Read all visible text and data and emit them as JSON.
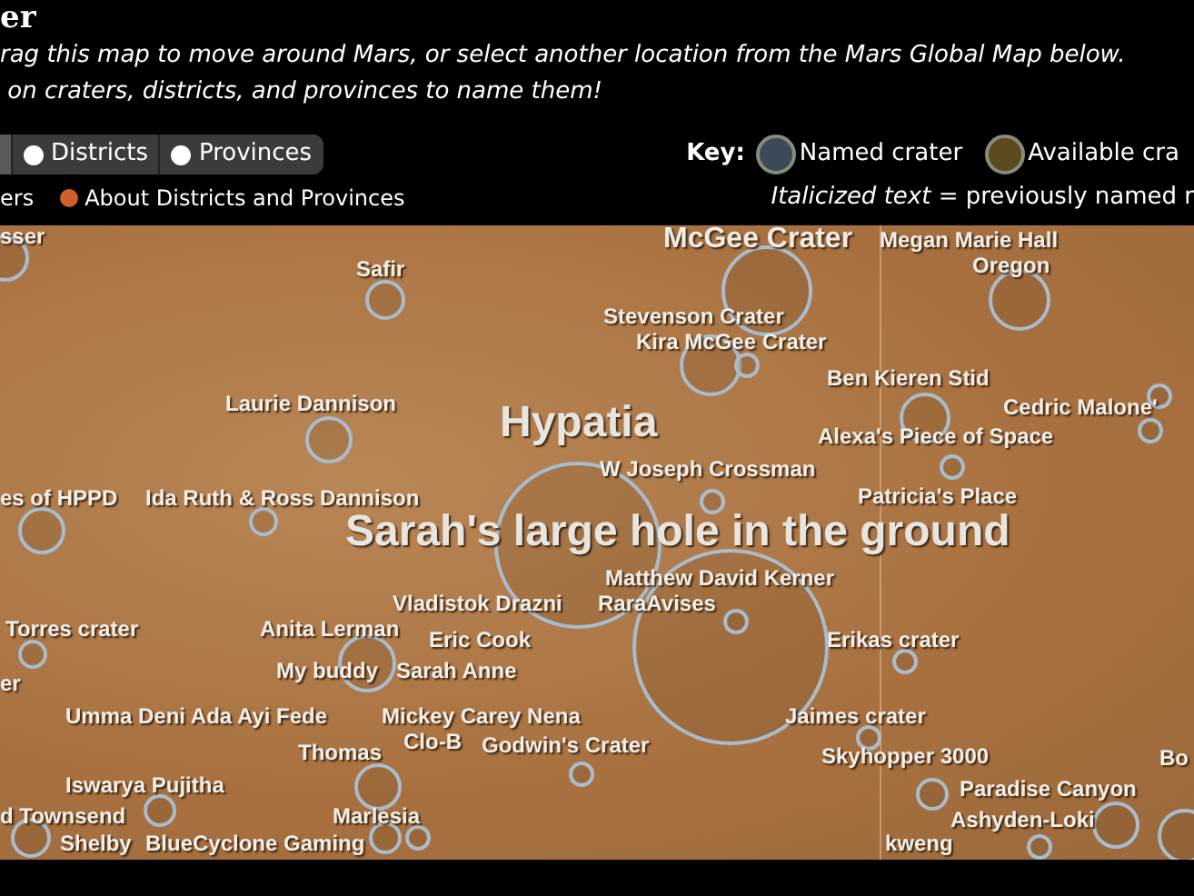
{
  "header": {
    "title": "er",
    "instructions": [
      "rag this map to move around Mars, or select another location from the Mars Global Map below.",
      " on craters, districts, and provinces to name them!"
    ]
  },
  "toggles": [
    {
      "selected": true
    },
    {
      "label": "Districts",
      "selected": false
    },
    {
      "label": "Provinces",
      "selected": false
    }
  ],
  "key": {
    "title": "Key:",
    "items": [
      {
        "label": "Named crater",
        "color": "#3c4a58"
      },
      {
        "label": "Available cra",
        "color": "#5a4a1e"
      }
    ],
    "note": "*Italicized text* = previously named r"
  },
  "links": [
    {
      "label": "ers",
      "kind": "plain"
    },
    {
      "label": "About Districts and Provinces",
      "kind": "help"
    }
  ],
  "map": {
    "labels": [
      {
        "text": "sser",
        "kind": "small"
      },
      {
        "text": "McGee Crater",
        "kind": "medium"
      },
      {
        "text": "Megan Marie Hall",
        "kind": "small"
      },
      {
        "text": "Safir",
        "kind": "small"
      },
      {
        "text": "Oregon",
        "kind": "small"
      },
      {
        "text": "Stevenson Crater",
        "kind": "small"
      },
      {
        "text": "Kira McGee Crater",
        "kind": "small"
      },
      {
        "text": "Ben Kieren Stid",
        "kind": "small"
      },
      {
        "text": "Laurie Dannison",
        "kind": "small"
      },
      {
        "text": "Hypatia",
        "kind": "large"
      },
      {
        "text": "Alexa's Piece of Space",
        "kind": "small"
      },
      {
        "text": "Cedric Malone'",
        "kind": "small"
      },
      {
        "text": "W Joseph Crossman",
        "kind": "small"
      },
      {
        "text": "es of HPPD",
        "kind": "small"
      },
      {
        "text": "Ida Ruth & Ross Dannison",
        "kind": "small"
      },
      {
        "text": "Patricia's Place",
        "kind": "small"
      },
      {
        "text": "Sarah's large hole in the ground",
        "kind": "large"
      },
      {
        "text": "Matthew David Kerner",
        "kind": "small"
      },
      {
        "text": "Vladistok Drazni",
        "kind": "small"
      },
      {
        "text": "RaraAvises",
        "kind": "small"
      },
      {
        "text": "Torres crater",
        "kind": "small"
      },
      {
        "text": "Anita Lerman",
        "kind": "small"
      },
      {
        "text": "Eric Cook",
        "kind": "small"
      },
      {
        "text": "Erikas crater",
        "kind": "small"
      },
      {
        "text": "er",
        "kind": "small"
      },
      {
        "text": "My buddy",
        "kind": "small"
      },
      {
        "text": "Sarah Anne",
        "kind": "small"
      },
      {
        "text": "Umma Deni Ada Ayi Fede",
        "kind": "small"
      },
      {
        "text": "Mickey Carey Nena",
        "kind": "small"
      },
      {
        "text": "Jaimes crater",
        "kind": "small"
      },
      {
        "text": "Thomas",
        "kind": "small"
      },
      {
        "text": "Clo-B",
        "kind": "small"
      },
      {
        "text": "Godwin's Crater",
        "kind": "small"
      },
      {
        "text": "Skyhopper 3000",
        "kind": "small"
      },
      {
        "text": "Bo",
        "kind": "small"
      },
      {
        "text": "Iswarya Pujitha",
        "kind": "small"
      },
      {
        "text": "Paradise Canyon",
        "kind": "small"
      },
      {
        "text": "d Townsend",
        "kind": "small"
      },
      {
        "text": "Marlesia",
        "kind": "small"
      },
      {
        "text": "Ashyden-Loki",
        "kind": "small"
      },
      {
        "text": "Shelby",
        "kind": "small"
      },
      {
        "text": "BlueCyclone Gaming",
        "kind": "small"
      },
      {
        "text": "kweng",
        "kind": "small"
      }
    ]
  }
}
